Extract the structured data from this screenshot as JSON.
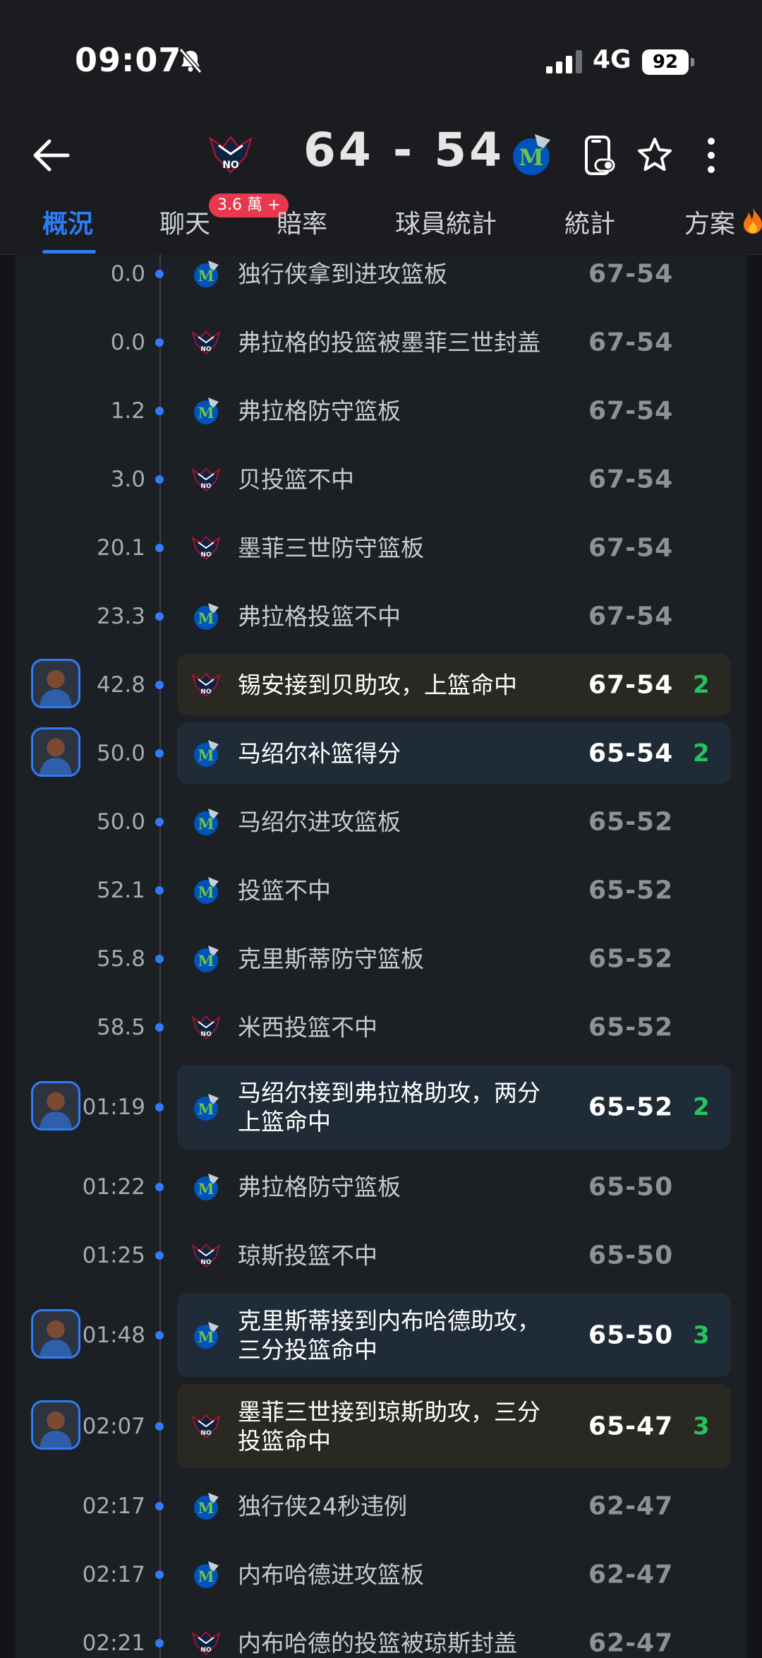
{
  "status_bar": {
    "time": "09:07",
    "network": "4G",
    "battery": "92"
  },
  "header": {
    "score": "64 - 54",
    "home_team": "NO",
    "away_team": "M"
  },
  "tabs": [
    {
      "label": "概況"
    },
    {
      "label": "聊天"
    },
    {
      "label": "賠率"
    },
    {
      "label": "球員統計"
    },
    {
      "label": "統計"
    },
    {
      "label": "方案"
    }
  ],
  "chat_badge": "3.6 萬 +",
  "plays": [
    {
      "time": "0.0",
      "team": "mav",
      "desc": "独行侠拿到进攻篮板",
      "score": "67-54"
    },
    {
      "time": "0.0",
      "team": "no",
      "desc": "弗拉格的投篮被墨菲三世封盖",
      "score": "67-54"
    },
    {
      "time": "1.2",
      "team": "mav",
      "desc": "弗拉格防守篮板",
      "score": "67-54"
    },
    {
      "time": "3.0",
      "team": "no",
      "desc": "贝投篮不中",
      "score": "67-54"
    },
    {
      "time": "20.1",
      "team": "no",
      "desc": "墨菲三世防守篮板",
      "score": "67-54"
    },
    {
      "time": "23.3",
      "team": "mav",
      "desc": "弗拉格投篮不中",
      "score": "67-54"
    },
    {
      "time": "42.8",
      "team": "no",
      "desc": "锡安接到贝助攻，上篮命中",
      "score": "67-54",
      "points": "2",
      "highlight": true,
      "avatar": true
    },
    {
      "time": "50.0",
      "team": "mav",
      "desc": "马绍尔补篮得分",
      "score": "65-54",
      "points": "2",
      "highlight": true,
      "avatar": true
    },
    {
      "time": "50.0",
      "team": "mav",
      "desc": "马绍尔进攻篮板",
      "score": "65-52"
    },
    {
      "time": "52.1",
      "team": "mav",
      "desc": "投篮不中",
      "score": "65-52"
    },
    {
      "time": "55.8",
      "team": "mav",
      "desc": "克里斯蒂防守篮板",
      "score": "65-52"
    },
    {
      "time": "58.5",
      "team": "no",
      "desc": "米西投篮不中",
      "score": "65-52"
    },
    {
      "time": "01:19",
      "team": "mav",
      "desc": "马绍尔接到弗拉格助攻，两分上篮命中",
      "score": "65-52",
      "points": "2",
      "highlight": true,
      "avatar": true,
      "tall": true
    },
    {
      "time": "01:22",
      "team": "mav",
      "desc": "弗拉格防守篮板",
      "score": "65-50"
    },
    {
      "time": "01:25",
      "team": "no",
      "desc": "琼斯投篮不中",
      "score": "65-50"
    },
    {
      "time": "01:48",
      "team": "mav",
      "desc": "克里斯蒂接到内布哈德助攻，三分投篮命中",
      "score": "65-50",
      "points": "3",
      "highlight": true,
      "avatar": true,
      "tall": true
    },
    {
      "time": "02:07",
      "team": "no",
      "desc": "墨菲三世接到琼斯助攻，三分投篮命中",
      "score": "65-47",
      "points": "3",
      "highlight": true,
      "avatar": true,
      "tall": true
    },
    {
      "time": "02:17",
      "team": "mav",
      "desc": "独行侠24秒违例",
      "score": "62-47"
    },
    {
      "time": "02:17",
      "team": "mav",
      "desc": "内布哈德进攻篮板",
      "score": "62-47"
    },
    {
      "time": "02:21",
      "team": "no",
      "desc": "内布哈德的投篮被琼斯封盖",
      "score": "62-47"
    }
  ],
  "colors": {
    "accent": "#2e7df6",
    "points": "#22c55e",
    "badge": "#e8384f"
  }
}
